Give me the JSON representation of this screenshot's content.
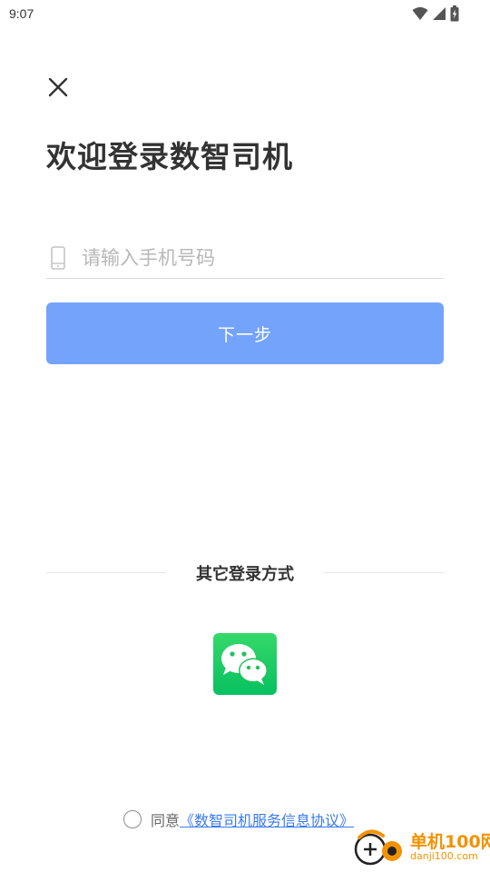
{
  "status_bar": {
    "time": "9:07"
  },
  "login": {
    "close_icon": "close-icon",
    "title": "欢迎登录数智司机",
    "phone_placeholder": "请输入手机号码",
    "next_label": "下一步"
  },
  "other_login": {
    "heading": "其它登录方式",
    "wechat_icon": "wechat-icon"
  },
  "agreement": {
    "prefix": "同意",
    "link": "《数智司机服务信息协议》"
  },
  "watermark": {
    "name": "单机100网",
    "url": "danji100.com"
  },
  "colors": {
    "primary_button": "#74a3fb",
    "link": "#3a7af0",
    "wechat_green": "#07c160",
    "watermark": "#f39200"
  }
}
